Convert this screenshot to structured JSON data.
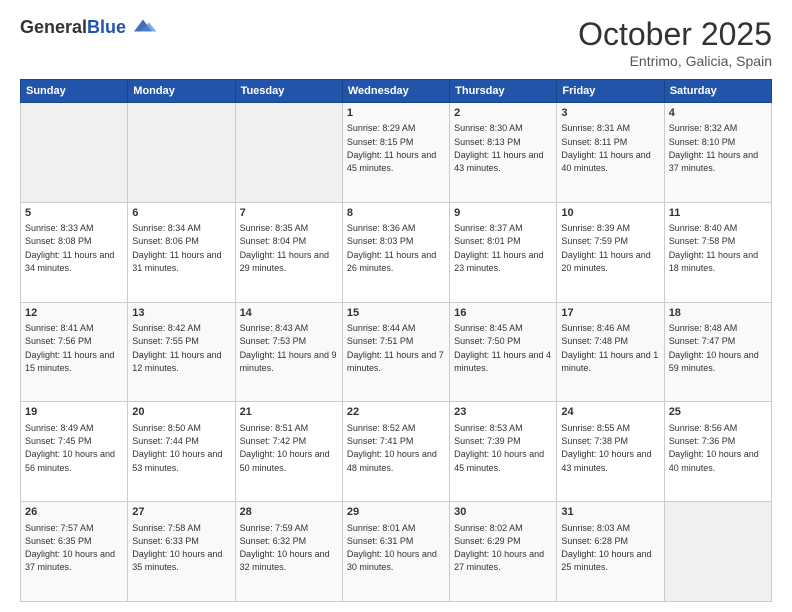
{
  "header": {
    "logo_general": "General",
    "logo_blue": "Blue",
    "month_title": "October 2025",
    "location": "Entrimo, Galicia, Spain"
  },
  "days_of_week": [
    "Sunday",
    "Monday",
    "Tuesday",
    "Wednesday",
    "Thursday",
    "Friday",
    "Saturday"
  ],
  "weeks": [
    [
      {
        "day": "",
        "info": ""
      },
      {
        "day": "",
        "info": ""
      },
      {
        "day": "",
        "info": ""
      },
      {
        "day": "1",
        "info": "Sunrise: 8:29 AM\nSunset: 8:15 PM\nDaylight: 11 hours and 45 minutes."
      },
      {
        "day": "2",
        "info": "Sunrise: 8:30 AM\nSunset: 8:13 PM\nDaylight: 11 hours and 43 minutes."
      },
      {
        "day": "3",
        "info": "Sunrise: 8:31 AM\nSunset: 8:11 PM\nDaylight: 11 hours and 40 minutes."
      },
      {
        "day": "4",
        "info": "Sunrise: 8:32 AM\nSunset: 8:10 PM\nDaylight: 11 hours and 37 minutes."
      }
    ],
    [
      {
        "day": "5",
        "info": "Sunrise: 8:33 AM\nSunset: 8:08 PM\nDaylight: 11 hours and 34 minutes."
      },
      {
        "day": "6",
        "info": "Sunrise: 8:34 AM\nSunset: 8:06 PM\nDaylight: 11 hours and 31 minutes."
      },
      {
        "day": "7",
        "info": "Sunrise: 8:35 AM\nSunset: 8:04 PM\nDaylight: 11 hours and 29 minutes."
      },
      {
        "day": "8",
        "info": "Sunrise: 8:36 AM\nSunset: 8:03 PM\nDaylight: 11 hours and 26 minutes."
      },
      {
        "day": "9",
        "info": "Sunrise: 8:37 AM\nSunset: 8:01 PM\nDaylight: 11 hours and 23 minutes."
      },
      {
        "day": "10",
        "info": "Sunrise: 8:39 AM\nSunset: 7:59 PM\nDaylight: 11 hours and 20 minutes."
      },
      {
        "day": "11",
        "info": "Sunrise: 8:40 AM\nSunset: 7:58 PM\nDaylight: 11 hours and 18 minutes."
      }
    ],
    [
      {
        "day": "12",
        "info": "Sunrise: 8:41 AM\nSunset: 7:56 PM\nDaylight: 11 hours and 15 minutes."
      },
      {
        "day": "13",
        "info": "Sunrise: 8:42 AM\nSunset: 7:55 PM\nDaylight: 11 hours and 12 minutes."
      },
      {
        "day": "14",
        "info": "Sunrise: 8:43 AM\nSunset: 7:53 PM\nDaylight: 11 hours and 9 minutes."
      },
      {
        "day": "15",
        "info": "Sunrise: 8:44 AM\nSunset: 7:51 PM\nDaylight: 11 hours and 7 minutes."
      },
      {
        "day": "16",
        "info": "Sunrise: 8:45 AM\nSunset: 7:50 PM\nDaylight: 11 hours and 4 minutes."
      },
      {
        "day": "17",
        "info": "Sunrise: 8:46 AM\nSunset: 7:48 PM\nDaylight: 11 hours and 1 minute."
      },
      {
        "day": "18",
        "info": "Sunrise: 8:48 AM\nSunset: 7:47 PM\nDaylight: 10 hours and 59 minutes."
      }
    ],
    [
      {
        "day": "19",
        "info": "Sunrise: 8:49 AM\nSunset: 7:45 PM\nDaylight: 10 hours and 56 minutes."
      },
      {
        "day": "20",
        "info": "Sunrise: 8:50 AM\nSunset: 7:44 PM\nDaylight: 10 hours and 53 minutes."
      },
      {
        "day": "21",
        "info": "Sunrise: 8:51 AM\nSunset: 7:42 PM\nDaylight: 10 hours and 50 minutes."
      },
      {
        "day": "22",
        "info": "Sunrise: 8:52 AM\nSunset: 7:41 PM\nDaylight: 10 hours and 48 minutes."
      },
      {
        "day": "23",
        "info": "Sunrise: 8:53 AM\nSunset: 7:39 PM\nDaylight: 10 hours and 45 minutes."
      },
      {
        "day": "24",
        "info": "Sunrise: 8:55 AM\nSunset: 7:38 PM\nDaylight: 10 hours and 43 minutes."
      },
      {
        "day": "25",
        "info": "Sunrise: 8:56 AM\nSunset: 7:36 PM\nDaylight: 10 hours and 40 minutes."
      }
    ],
    [
      {
        "day": "26",
        "info": "Sunrise: 7:57 AM\nSunset: 6:35 PM\nDaylight: 10 hours and 37 minutes."
      },
      {
        "day": "27",
        "info": "Sunrise: 7:58 AM\nSunset: 6:33 PM\nDaylight: 10 hours and 35 minutes."
      },
      {
        "day": "28",
        "info": "Sunrise: 7:59 AM\nSunset: 6:32 PM\nDaylight: 10 hours and 32 minutes."
      },
      {
        "day": "29",
        "info": "Sunrise: 8:01 AM\nSunset: 6:31 PM\nDaylight: 10 hours and 30 minutes."
      },
      {
        "day": "30",
        "info": "Sunrise: 8:02 AM\nSunset: 6:29 PM\nDaylight: 10 hours and 27 minutes."
      },
      {
        "day": "31",
        "info": "Sunrise: 8:03 AM\nSunset: 6:28 PM\nDaylight: 10 hours and 25 minutes."
      },
      {
        "day": "",
        "info": ""
      }
    ]
  ]
}
